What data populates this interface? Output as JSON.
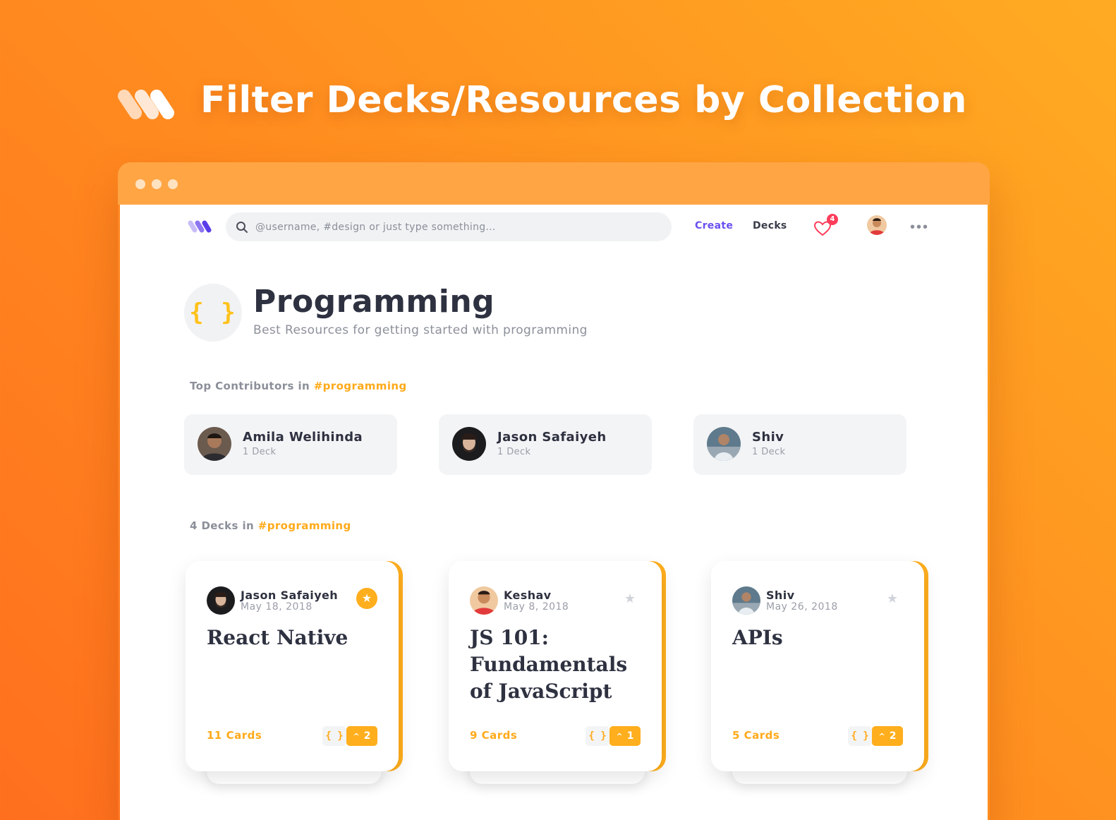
{
  "hero": {
    "title": "Filter Decks/Resources by Collection"
  },
  "nav": {
    "search_placeholder": "@username, #design or just type something...",
    "create_label": "Create",
    "decks_label": "Decks",
    "notification_count": "4"
  },
  "collection": {
    "icon": "{ }",
    "title": "Programming",
    "subtitle": "Best Resources for getting started with programming"
  },
  "contributors_section": {
    "prefix": "Top Contributors in ",
    "tag": "#programming"
  },
  "contributors": [
    {
      "name": "Amila Welihinda",
      "count": "1 Deck"
    },
    {
      "name": "Jason Safaiyeh",
      "count": "1 Deck"
    },
    {
      "name": "Shiv",
      "count": "1 Deck"
    }
  ],
  "decks_section": {
    "prefix": "4 Decks in ",
    "tag": "#programming"
  },
  "decks": [
    {
      "author": "Jason Safaiyeh",
      "date": "May 18, 2018",
      "title": "React Native",
      "cards": "11 Cards",
      "tag_icon": "{ }",
      "votes": "2",
      "starred": true
    },
    {
      "author": "Keshav",
      "date": "May 8, 2018",
      "title": "JS 101: Fundamentals of JavaScript",
      "cards": "9 Cards",
      "tag_icon": "{ }",
      "votes": "1",
      "starred": false
    },
    {
      "author": "Shiv",
      "date": "May 26, 2018",
      "title": "APIs",
      "cards": "5 Cards",
      "tag_icon": "{ }",
      "votes": "2",
      "starred": false
    }
  ],
  "colors": {
    "accent_orange": "#ffae1d",
    "brand_purple": "#6a4ff0",
    "heart_red": "#ff3d5a",
    "text_dark": "#2e3140"
  },
  "icons": {
    "brand": "brand-logo-icon",
    "search": "search-icon",
    "heart": "heart-icon",
    "more": "more-dots-icon",
    "star": "star-icon",
    "upvote": "chevron-up-icon"
  }
}
